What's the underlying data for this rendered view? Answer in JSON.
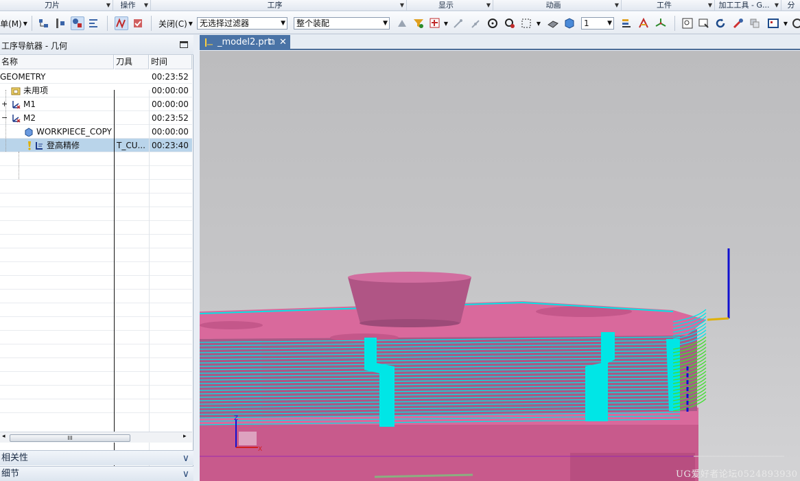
{
  "ribbon_groups": [
    {
      "label": "刀片"
    },
    {
      "label": "操作"
    },
    {
      "label": "工序"
    },
    {
      "label": "显示"
    },
    {
      "label": "动画"
    },
    {
      "label": "工件"
    },
    {
      "label": "加工工具 - G..."
    },
    {
      "label": "分"
    }
  ],
  "toolbar": {
    "menu_label": "单(M)",
    "close_label": "关闭(C)",
    "filter_combo": "无选择过滤器",
    "scope_combo": "整个装配",
    "count_combo": "1"
  },
  "navigator": {
    "title": "工序导航器 - 几何",
    "columns": {
      "name": "名称",
      "tool": "刀具",
      "time": "时间"
    },
    "rows": [
      {
        "name": "GEOMETRY",
        "tool": "",
        "time": "00:23:52"
      },
      {
        "name": "未用项",
        "tool": "",
        "time": "00:00:00"
      },
      {
        "name": "M1",
        "tool": "",
        "time": "00:00:00"
      },
      {
        "name": "M2",
        "tool": "",
        "time": "00:23:52"
      },
      {
        "name": "WORKPIECE_COPY",
        "tool": "",
        "time": "00:00:00"
      },
      {
        "name": "登高精修",
        "tool": "T_CU...",
        "time": "00:23:40"
      }
    ],
    "scroll_thumb": "III"
  },
  "panels": {
    "dependencies": "相关性",
    "details": "细节"
  },
  "graphics": {
    "file_tab": "_model2.prt"
  },
  "watermark": "UG爱好者论坛0524893930",
  "colors": {
    "part_pink": "#d9699c",
    "toolpath_cyan": "#00e6e6",
    "selected_row": "#b9d4ea",
    "tab_blue": "#4a73a6"
  }
}
